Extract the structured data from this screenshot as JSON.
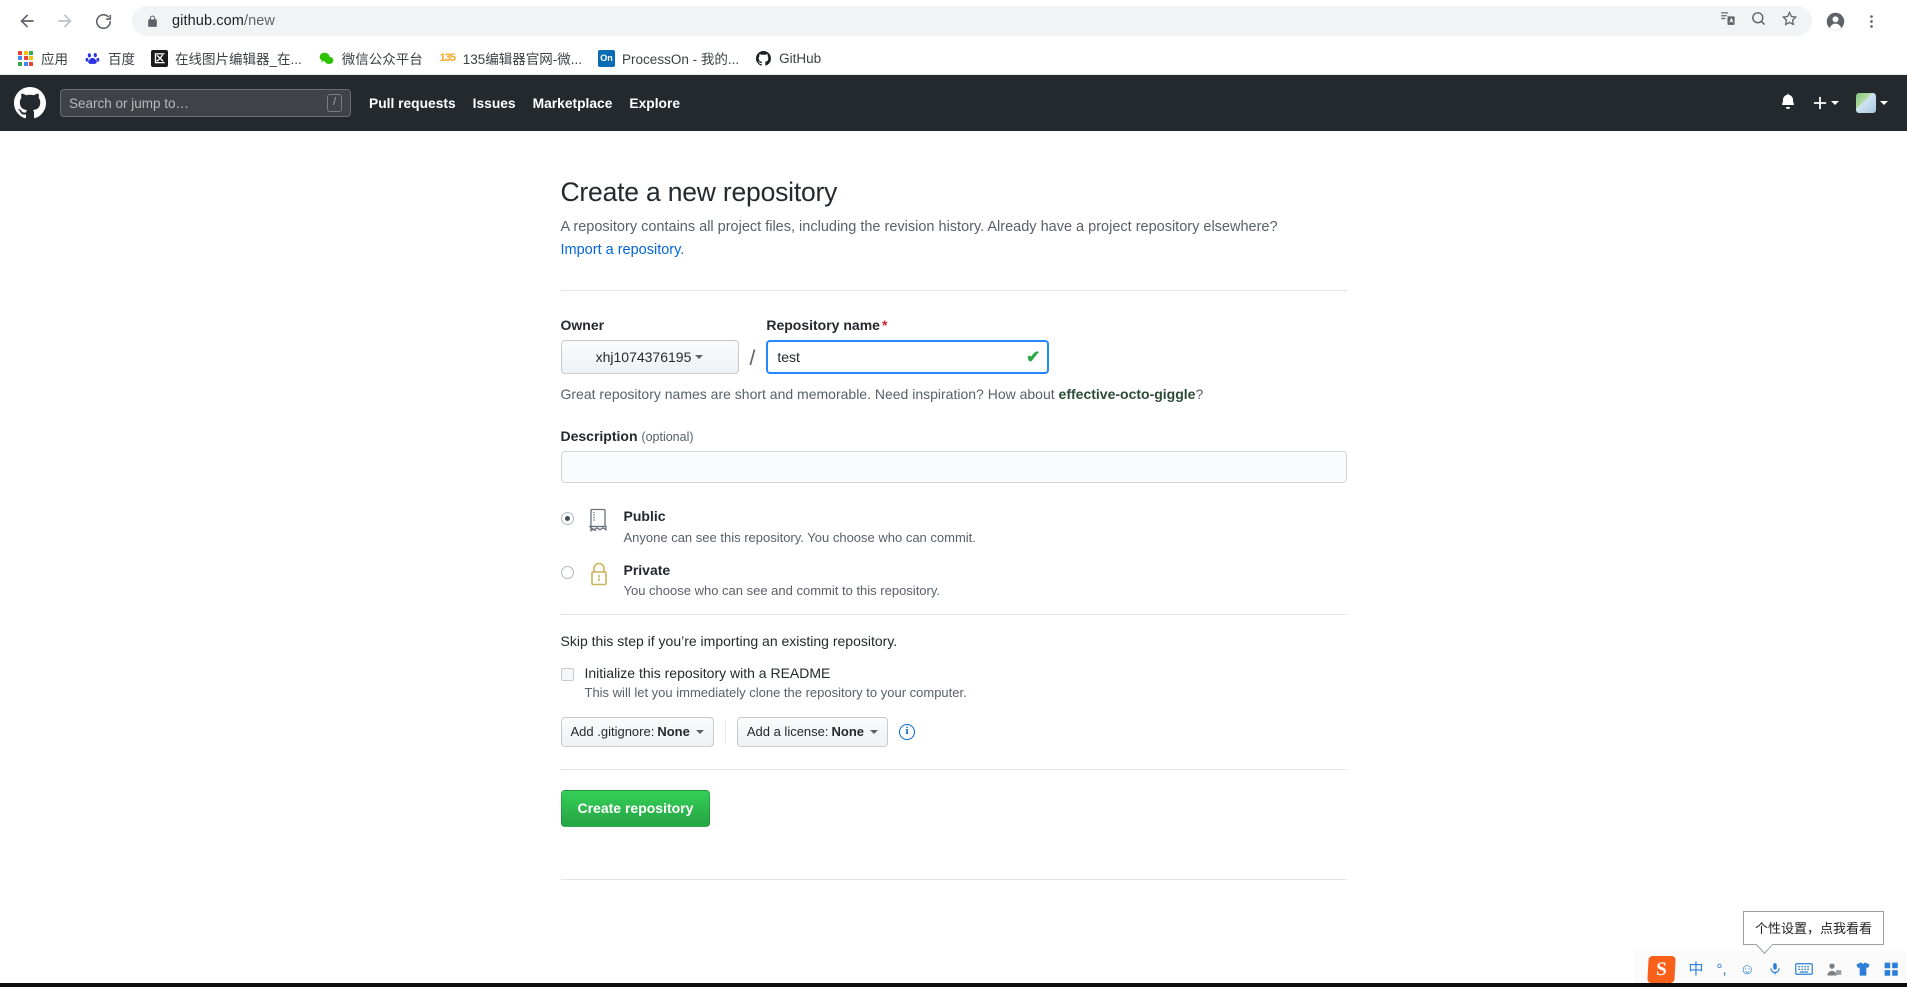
{
  "browser": {
    "url_prefix": "github.com",
    "url_suffix": "/new",
    "back_label": "Back",
    "forward_label": "Forward",
    "reload_label": "Reload",
    "lock_label": "View site information",
    "translate_label": "translate-icon",
    "search_page_label": "search-icon",
    "bookmark_label": "star-icon",
    "profile_label": "profile-icon",
    "menu_label": "more-menu-icon",
    "bookmarks": [
      {
        "label": "应用",
        "icon": "apps-grid-icon"
      },
      {
        "label": "百度",
        "icon": "baidu-icon"
      },
      {
        "label": "在线图片编辑器_在...",
        "icon": "image-editor-icon"
      },
      {
        "label": "微信公众平台",
        "icon": "wechat-icon"
      },
      {
        "label": "135编辑器官网-微...",
        "icon": "135editor-icon"
      },
      {
        "label": "ProcessOn - 我的...",
        "icon": "processon-icon"
      },
      {
        "label": "GitHub",
        "icon": "github-icon"
      }
    ]
  },
  "github_header": {
    "logo": "github-mark-icon",
    "search_placeholder": "Search or jump to…",
    "search_shortcut": "/",
    "nav": [
      "Pull requests",
      "Issues",
      "Marketplace",
      "Explore"
    ],
    "notifications_icon": "bell-icon",
    "create_new_icon": "plus-icon",
    "avatar_icon": "user-avatar"
  },
  "main": {
    "title": "Create a new repository",
    "subtitle": "A repository contains all project files, including the revision history. Already have a project repository elsewhere?",
    "import_link": "Import a repository.",
    "owner": {
      "label": "Owner",
      "value": "xhj1074376195",
      "separator": "/"
    },
    "repo_name": {
      "label": "Repository name",
      "required_mark": "*",
      "value": "test",
      "valid_icon": "✔"
    },
    "hint_prefix": "Great repository names are short and memorable. Need inspiration? How about ",
    "hint_suggestion": "effective-octo-giggle",
    "hint_suffix": "?",
    "description": {
      "label": "Description",
      "optional": "(optional)",
      "value": "",
      "placeholder": ""
    },
    "visibility": [
      {
        "id": "public",
        "title": "Public",
        "desc": "Anyone can see this repository. You choose who can commit.",
        "selected": true,
        "icon": "repo-book-icon"
      },
      {
        "id": "private",
        "title": "Private",
        "desc": "You choose who can see and commit to this repository.",
        "selected": false,
        "icon": "lock-icon"
      }
    ],
    "skip_text": "Skip this step if you’re importing an existing repository.",
    "readme": {
      "label": "Initialize this repository with a README",
      "desc": "This will let you immediately clone the repository to your computer.",
      "checked": false
    },
    "gitignore_button": {
      "prefix": "Add .gitignore:",
      "value": "None"
    },
    "license_button": {
      "prefix": "Add a license:",
      "value": "None"
    },
    "license_info_icon": "info-icon",
    "submit_label": "Create repository"
  },
  "ime": {
    "tooltip": "个性设置，点我看看",
    "logo": "S",
    "items": [
      {
        "name": "language-mode",
        "glyph": "中"
      },
      {
        "name": "punctuation-mode",
        "glyph": "°,"
      },
      {
        "name": "emoji-icon",
        "glyph": "☺"
      },
      {
        "name": "microphone-icon",
        "glyph": "🎤"
      },
      {
        "name": "keyboard-icon",
        "glyph": "⌨"
      },
      {
        "name": "user-settings-icon",
        "glyph": "👤"
      },
      {
        "name": "skin-icon",
        "glyph": "👕"
      },
      {
        "name": "toolbox-icon",
        "glyph": "▦"
      }
    ]
  },
  "colors": {
    "github_header": "#24292e",
    "link": "#0366d6",
    "focus_border": "#2188ff",
    "success_green": "#28a745",
    "required_red": "#cb2431"
  }
}
